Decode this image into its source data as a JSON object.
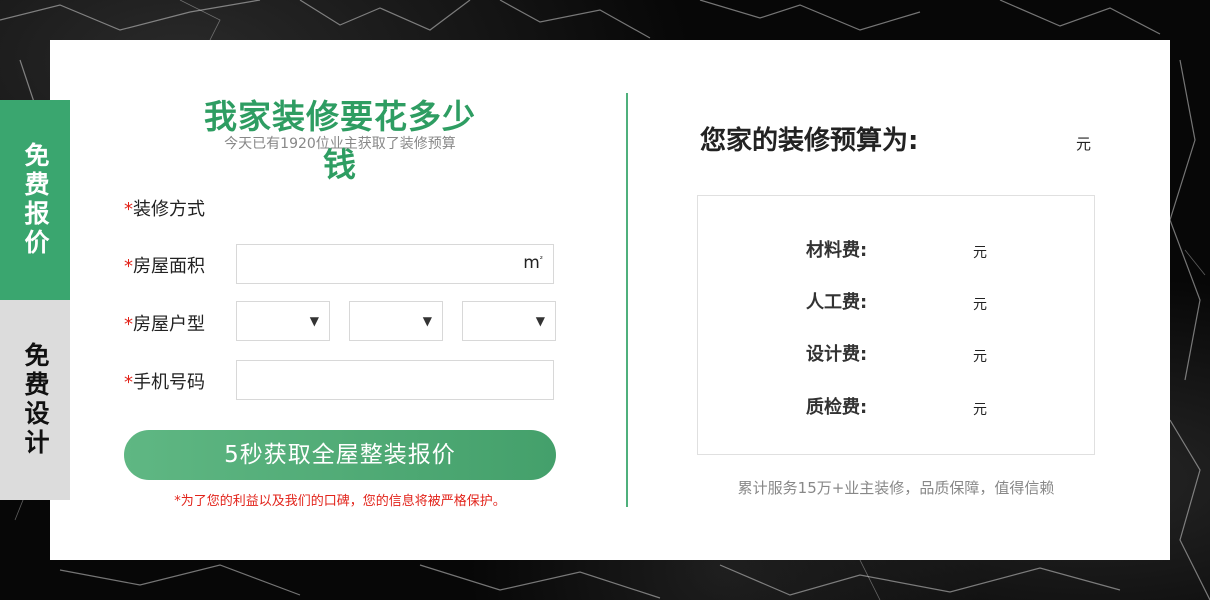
{
  "side_tabs": {
    "quote": "免费报价",
    "design": "免费设计"
  },
  "form": {
    "title": "我家装修要花多少钱",
    "subtitle": "今天已有1920位业主获取了装修预算",
    "required_mark": "*",
    "fields": {
      "method": "装修方式",
      "area": "房屋面积",
      "layout": "房屋户型",
      "phone": "手机号码"
    },
    "area_unit": "m",
    "area_unit_sup": "²",
    "dropdown_arrow": "▼",
    "submit_label": "5秒获取全屋整装报价",
    "privacy_note": "*为了您的利益以及我们的口碑，您的信息将被严格保护。"
  },
  "result": {
    "title": "您家的装修预算为:",
    "unit": "元",
    "items": [
      {
        "label": "材料费:",
        "unit": "元"
      },
      {
        "label": "人工费:",
        "unit": "元"
      },
      {
        "label": "设计费:",
        "unit": "元"
      },
      {
        "label": "质检费:",
        "unit": "元"
      }
    ],
    "footnote": "累计服务15万+业主装修，品质保障，值得信赖"
  },
  "colors": {
    "brand_green": "#2e9d62",
    "button_green": "#4fa873",
    "required_red": "#e2231a",
    "tab_inactive": "#dcdcdc"
  }
}
